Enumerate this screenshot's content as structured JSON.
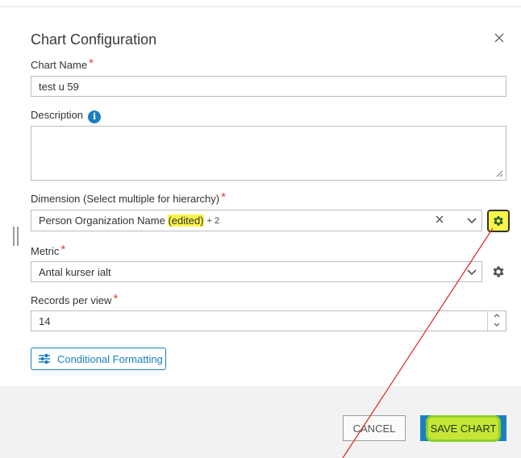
{
  "dialog": {
    "title": "Chart Configuration",
    "close_icon": "close-icon"
  },
  "chart_name": {
    "label": "Chart Name",
    "required_mark": "*",
    "value": "test u 59"
  },
  "description": {
    "label": "Description",
    "info_icon_glyph": "i",
    "value": ""
  },
  "dimension": {
    "label": "Dimension (Select multiple for hierarchy)",
    "required_mark": "*",
    "value": "Person Organization Name",
    "edited_tag": "(edited)",
    "extra_count": "+ 2"
  },
  "metric": {
    "label": "Metric",
    "required_mark": "*",
    "value": "Antal kurser ialt"
  },
  "records": {
    "label": "Records per view",
    "required_mark": "*",
    "value": "14"
  },
  "conditional_formatting": {
    "label": "Conditional Formatting"
  },
  "footer": {
    "cancel_label": "CANCEL",
    "save_label": "SAVE CHART"
  },
  "colors": {
    "accent": "#1a7fc1",
    "required": "#e0443a",
    "highlight": "#f8f54a",
    "annotation_line": "#e0241b"
  }
}
